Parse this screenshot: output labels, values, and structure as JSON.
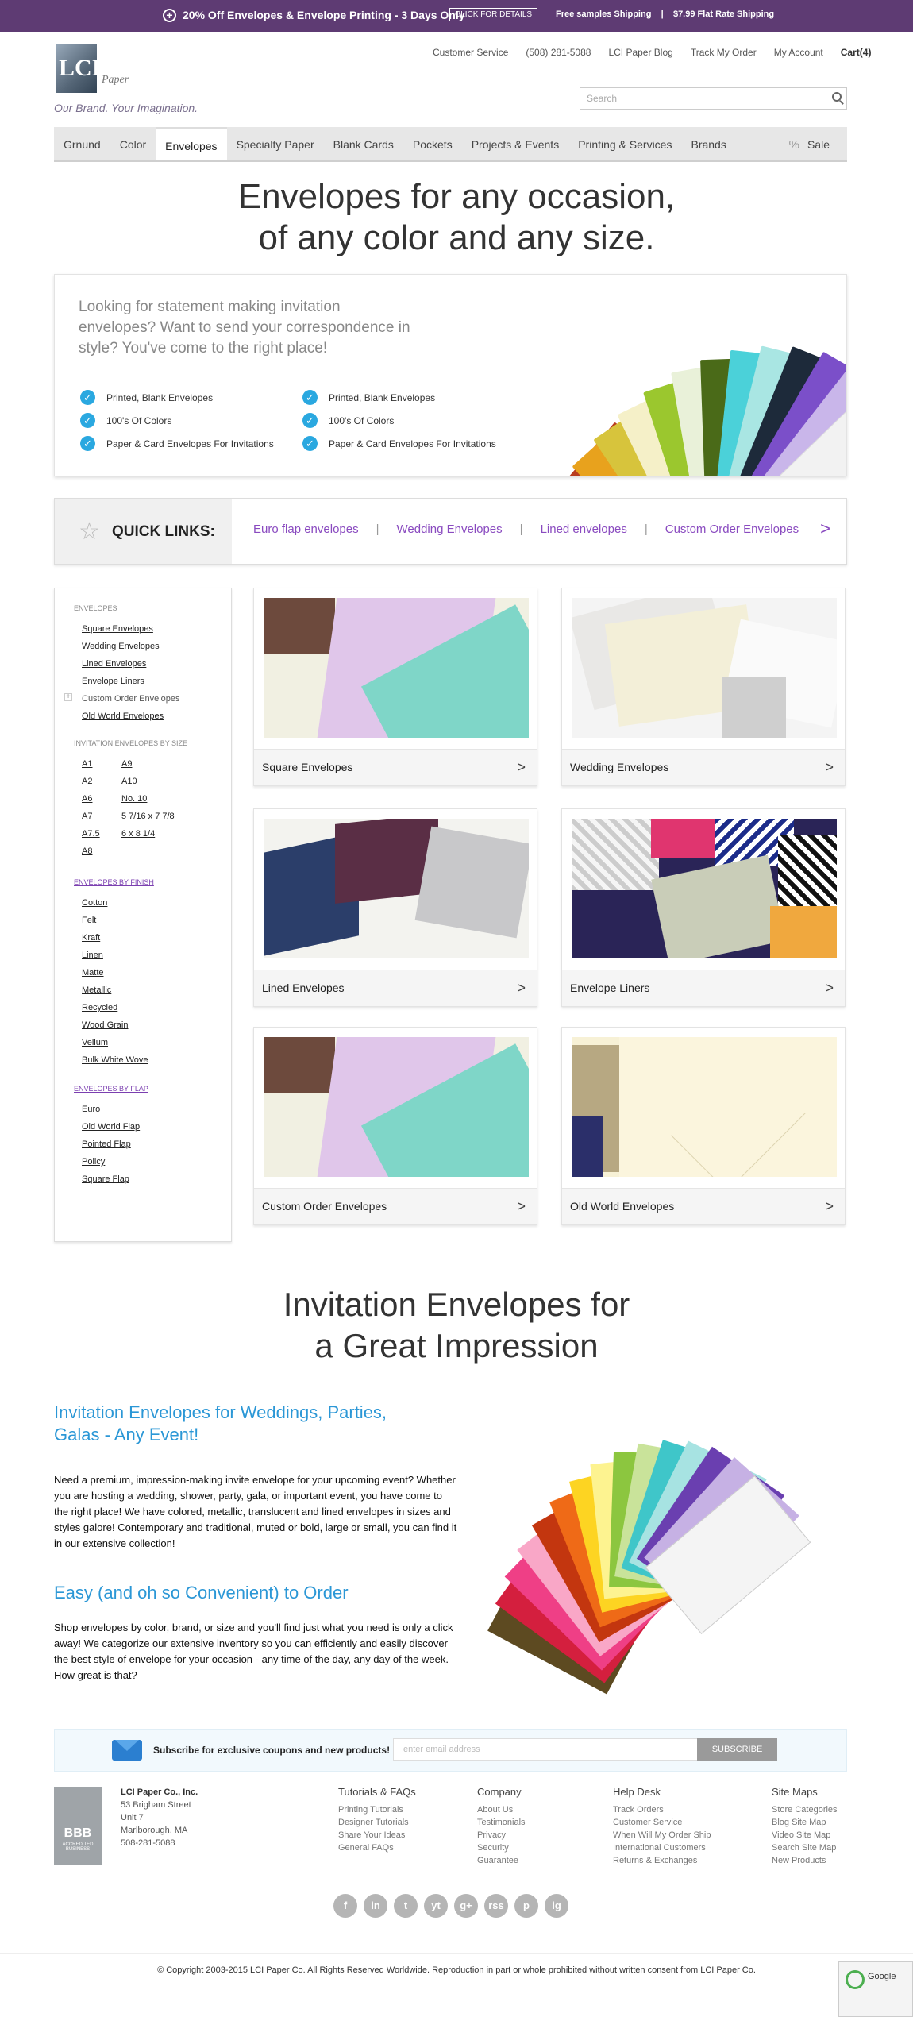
{
  "promo": {
    "text": "20% Off Envelopes & Envelope Printing - 3 Days Only",
    "button": "CLICK FOR DETAILS",
    "shipping": "Free samples Shipping    |    $7.99 Flat Rate Shipping"
  },
  "header": {
    "logo_text": "LCI",
    "logo_sub": "Paper",
    "tagline": "Our Brand. Your Imagination.",
    "links": [
      "Customer Service",
      "(508) 281-5088",
      "LCI Paper Blog",
      "Track My Order",
      "My Account",
      "Cart(4)"
    ],
    "search_placeholder": "Search"
  },
  "nav": {
    "items": [
      "Grnund",
      "Color",
      "Envelopes",
      "Specialty Paper",
      "Blank Cards",
      "Pockets",
      "Projects & Events",
      "Printing & Services",
      "Brands"
    ],
    "sale": "Sale",
    "active": "Envelopes"
  },
  "hero": {
    "title_1": "Envelopes for any occasion,",
    "title_2": "of any color and any size.",
    "lead": "Looking for statement making invitation envelopes? Want to send your correspondence in style? You've come to the right place!",
    "features_left": [
      "Printed, Blank Envelopes",
      "100's Of Colors",
      "Paper & Card Envelopes For Invitations"
    ],
    "features_right": [
      "Printed, Blank Envelopes",
      "100's Of Colors",
      "Paper & Card Envelopes For Invitations"
    ]
  },
  "quick_links": {
    "label": "QUICK LINKS:",
    "links": [
      "Euro flap envelopes",
      "Wedding Envelopes",
      "Lined envelopes",
      "Custom Order Envelopes"
    ]
  },
  "sidebar": {
    "h1": "ENVELOPES",
    "envelopes": [
      "Square Envelopes",
      "Wedding Envelopes",
      "Lined Envelopes",
      "Envelope Liners",
      "Custom Order Envelopes",
      "Old World Envelopes"
    ],
    "h2": "INVITATION ENVELOPES BY SIZE",
    "sizes_left": [
      "A1",
      "A2",
      "A6",
      "A7",
      "A7.5",
      "A8"
    ],
    "sizes_right": [
      "A9",
      "A10",
      "No. 10",
      "5 7/16 x 7 7/8",
      "6 x 8 1/4"
    ],
    "h3": "ENVELOPES BY FINISH",
    "finishes": [
      "Cotton",
      "Felt",
      "Kraft",
      "Linen",
      "Matte",
      "Metallic",
      "Recycled",
      "Wood Grain",
      "Vellum",
      "Bulk White Wove"
    ],
    "h4": "ENVELOPES BY FLAP",
    "flaps": [
      "Euro",
      "Old World Flap",
      "Pointed Flap",
      "Policy",
      "Square Flap"
    ]
  },
  "tiles": [
    "Square Envelopes",
    "Wedding Envelopes",
    "Lined Envelopes",
    "Envelope Liners",
    "Custom Order Envelopes",
    "Old World Envelopes"
  ],
  "impression": {
    "title_1": "Invitation Envelopes for",
    "title_2": "a Great Impression"
  },
  "content": {
    "h1": "Invitation Envelopes for Weddings, Parties, Galas - Any Event!",
    "p1": "Need a premium, impression-making invite envelope for your upcoming event? Whether you are hosting a wedding, shower, party, gala, or important event, you have come to the right place! We have colored, metallic, translucent and lined envelopes in sizes and styles galore! Contemporary and traditional, muted or bold, large or small, you can find it in our extensive collection!",
    "h2": "Easy (and oh so Convenient) to Order",
    "p2": "Shop envelopes by color, brand, or size and you'll find just what you need is only a click away! We categorize our extensive inventory so you can efficiently and easily discover the best style of envelope for your occasion - any time of the day, any day of the week. How great is that?"
  },
  "subscribe": {
    "text": "Subscribe for exclusive coupons and new products!",
    "placeholder": "enter email address",
    "button": "SUBSCRIBE"
  },
  "footer": {
    "company_lines": [
      "LCI Paper Co., Inc.",
      "53 Brigham Street",
      "Unit 7",
      "Marlborough, MA",
      "508-281-5088"
    ],
    "bbb": "BBB",
    "bbb_sub": "ACCREDITED BUSINESS",
    "cols": [
      {
        "title": "Tutorials & FAQs",
        "items": [
          "Printing Tutorials",
          "Designer Tutorials",
          "Share Your Ideas",
          "General FAQs"
        ]
      },
      {
        "title": "Company",
        "items": [
          "About Us",
          "Testimonials",
          "Privacy",
          "Security",
          "Guarantee"
        ]
      },
      {
        "title": "Help Desk",
        "items": [
          "Track Orders",
          "Customer Service",
          "When Will My Order Ship",
          "International Customers",
          "Returns & Exchanges"
        ]
      },
      {
        "title": "Site Maps",
        "items": [
          "Store Categories",
          "Blog Site Map",
          "Video Site Map",
          "Search Site Map",
          "New Products"
        ]
      }
    ],
    "social": [
      "f",
      "in",
      "t",
      "yt",
      "g+",
      "rss",
      "p",
      "ig"
    ],
    "copyright": "© Copyright 2003-2015 LCI Paper Co. All Rights Reserved Worldwide. Reproduction in part or whole prohibited without written consent from LCI Paper Co.",
    "badge": "Google"
  }
}
